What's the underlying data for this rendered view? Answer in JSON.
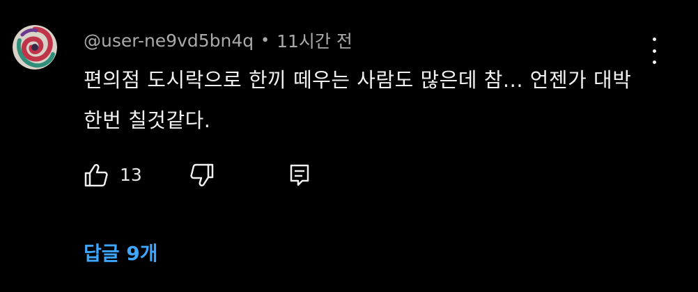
{
  "comment": {
    "author": "@user-ne9vd5bn4q",
    "separator": "•",
    "timestamp": "11시간 전",
    "text": "편의점 도시락으로 한끼 떼우는 사람도 많은데 참...  언젠가 대박 한번 칠것같다.",
    "like_count": "13",
    "replies_label": "답글 9개"
  },
  "icons": {
    "avatar": "swirl-avatar",
    "more": "vertical-dots-icon",
    "like": "thumbs-up-icon",
    "dislike": "thumbs-down-icon",
    "reply": "comment-reply-icon"
  },
  "colors": {
    "background": "#000000",
    "primary_text": "#f1f1f1",
    "secondary_text": "#aaaaaa",
    "link": "#3ea6ff"
  }
}
